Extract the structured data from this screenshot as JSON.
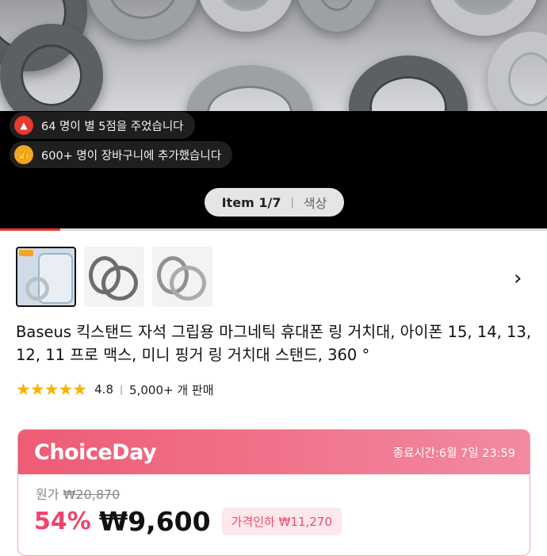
{
  "notices": [
    {
      "icon": "fire-icon",
      "text": "64 명이 별 5점을 주었습니다"
    },
    {
      "icon": "thumbs-up-icon",
      "text": "600+ 명이 장바구니에 추가했습니다"
    }
  ],
  "gallery": {
    "counter": "Item 1/7",
    "option_label": "색상",
    "progress": 0.11
  },
  "thumbnails": [
    {
      "name": "thumbnail-phone-ring",
      "selected": true
    },
    {
      "name": "thumbnail-gray-ring",
      "selected": false
    },
    {
      "name": "thumbnail-silver-ring",
      "selected": false
    }
  ],
  "product": {
    "title": "Baseus 킥스탠드 자석 그립용 마그네틱 휴대폰 링 거치대, 아이폰 15, 14, 13, 12, 11 프로 맥스, 미니 핑거 링 거치대 스탠드, 360 °",
    "rating": "4.8",
    "stars": 5,
    "sold": "5,000+ 개 판매"
  },
  "price_card": {
    "brand": "ChoiceDay",
    "ends_at": "종료시간:6월 7일 23:59",
    "original_label": "원가",
    "original_price": "₩20,870",
    "discount": "54%",
    "price": "₩9,600",
    "price_cut": "가격인하 ₩11,270"
  },
  "colors": {
    "accent_red": "#e83a2f",
    "choice_pink": "#ee5b75",
    "star": "#f5b301"
  }
}
